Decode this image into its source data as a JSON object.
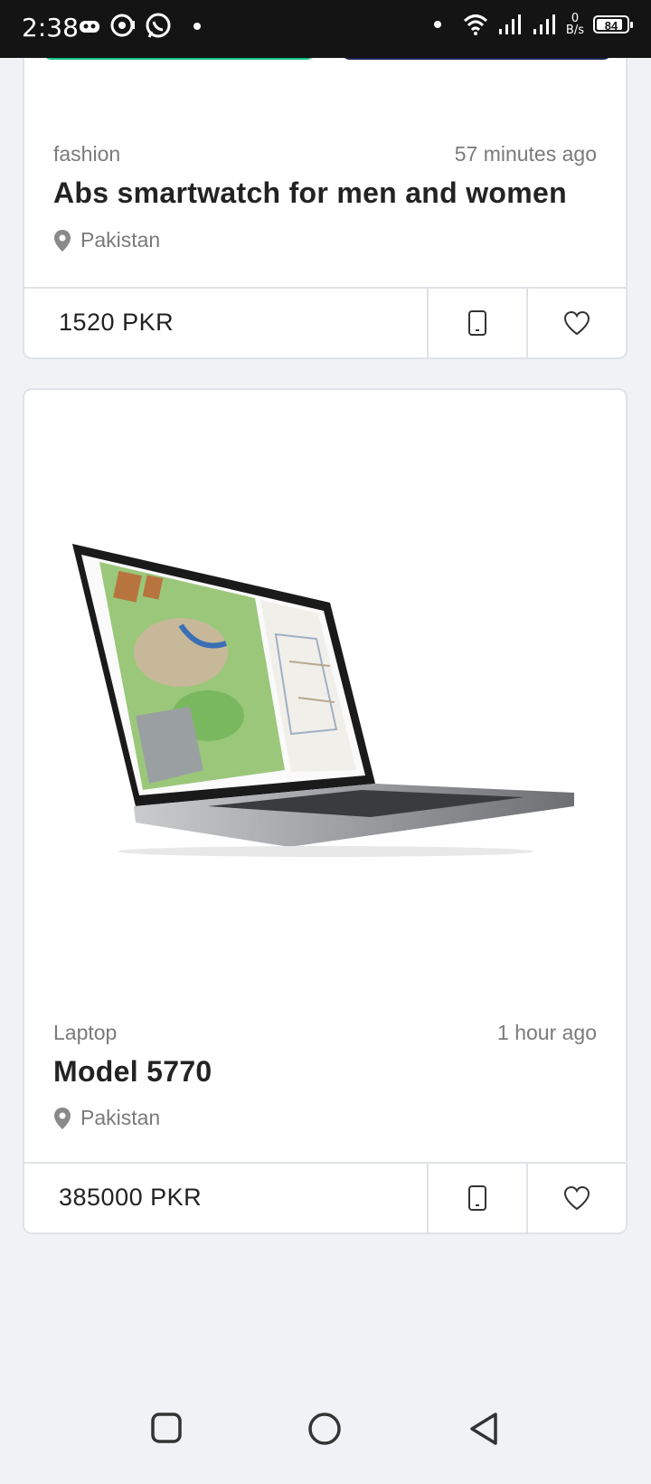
{
  "status_bar": {
    "time": "2:38",
    "speed_value": "0",
    "speed_unit": "B/s",
    "battery": "84",
    "icons": [
      "gamepad-icon",
      "chat-icon",
      "whatsapp-icon",
      "dot-icon",
      "wifi-icon",
      "signal-icon",
      "signal-icon",
      "battery-icon"
    ]
  },
  "listings": [
    {
      "category": "fashion",
      "time_ago": "57 minutes ago",
      "title": "Abs smartwatch for men and women",
      "location": "Pakistan",
      "price": "1520 PKR"
    },
    {
      "category": "Laptop",
      "time_ago": "1 hour ago",
      "title": "Model 5770",
      "location": "Pakistan",
      "price": "385000 PKR"
    }
  ],
  "colors": {
    "accent_green": "#16c28a",
    "navy": "#1d2454",
    "background": "#f0f2f6"
  }
}
